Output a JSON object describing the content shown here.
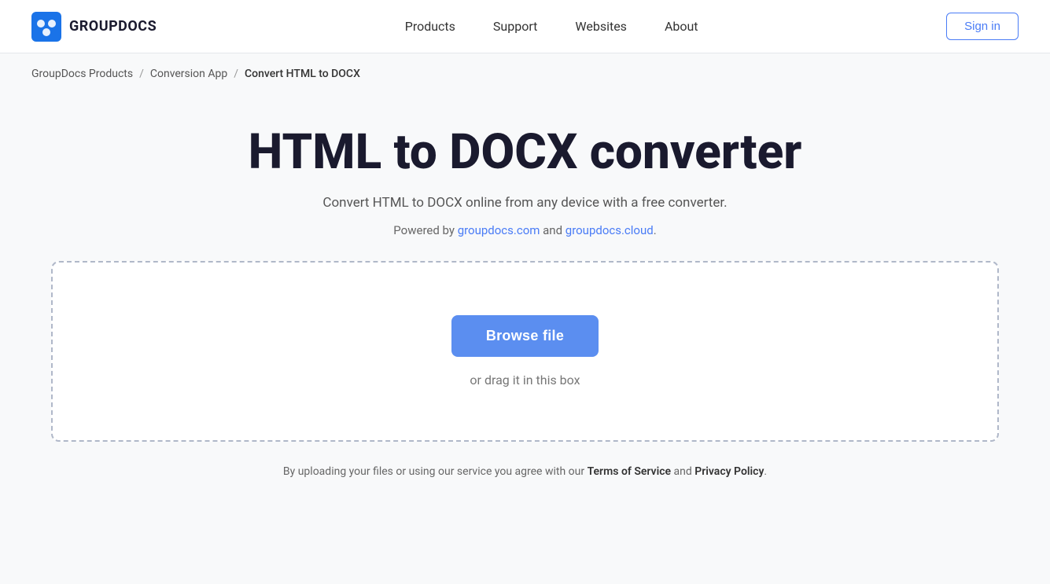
{
  "header": {
    "logo_text": "GROUPDOCS",
    "nav": {
      "items": [
        {
          "label": "Products",
          "id": "products"
        },
        {
          "label": "Support",
          "id": "support"
        },
        {
          "label": "Websites",
          "id": "websites"
        },
        {
          "label": "About",
          "id": "about"
        }
      ]
    },
    "signin_label": "Sign in"
  },
  "breadcrumb": {
    "items": [
      {
        "label": "GroupDocs Products",
        "href": "#"
      },
      {
        "label": "Conversion App",
        "href": "#"
      },
      {
        "label": "Convert HTML to DOCX",
        "current": true
      }
    ],
    "separator": "/"
  },
  "main": {
    "title": "HTML to DOCX converter",
    "subtitle": "Convert HTML to DOCX online from any device with a free converter.",
    "powered_by_text": "Powered by ",
    "powered_by_link1": "groupdocs.com",
    "powered_by_link1_href": "#",
    "powered_by_and": " and ",
    "powered_by_link2": "groupdocs.cloud",
    "powered_by_link2_href": "#",
    "powered_by_end": ".",
    "dropzone": {
      "browse_label": "Browse file",
      "drag_text": "or drag it in this box"
    },
    "footer_note_prefix": "By uploading your files or using our service you agree with our ",
    "footer_tos_label": "Terms of Service",
    "footer_and": " and ",
    "footer_privacy_label": "Privacy Policy",
    "footer_note_suffix": "."
  }
}
